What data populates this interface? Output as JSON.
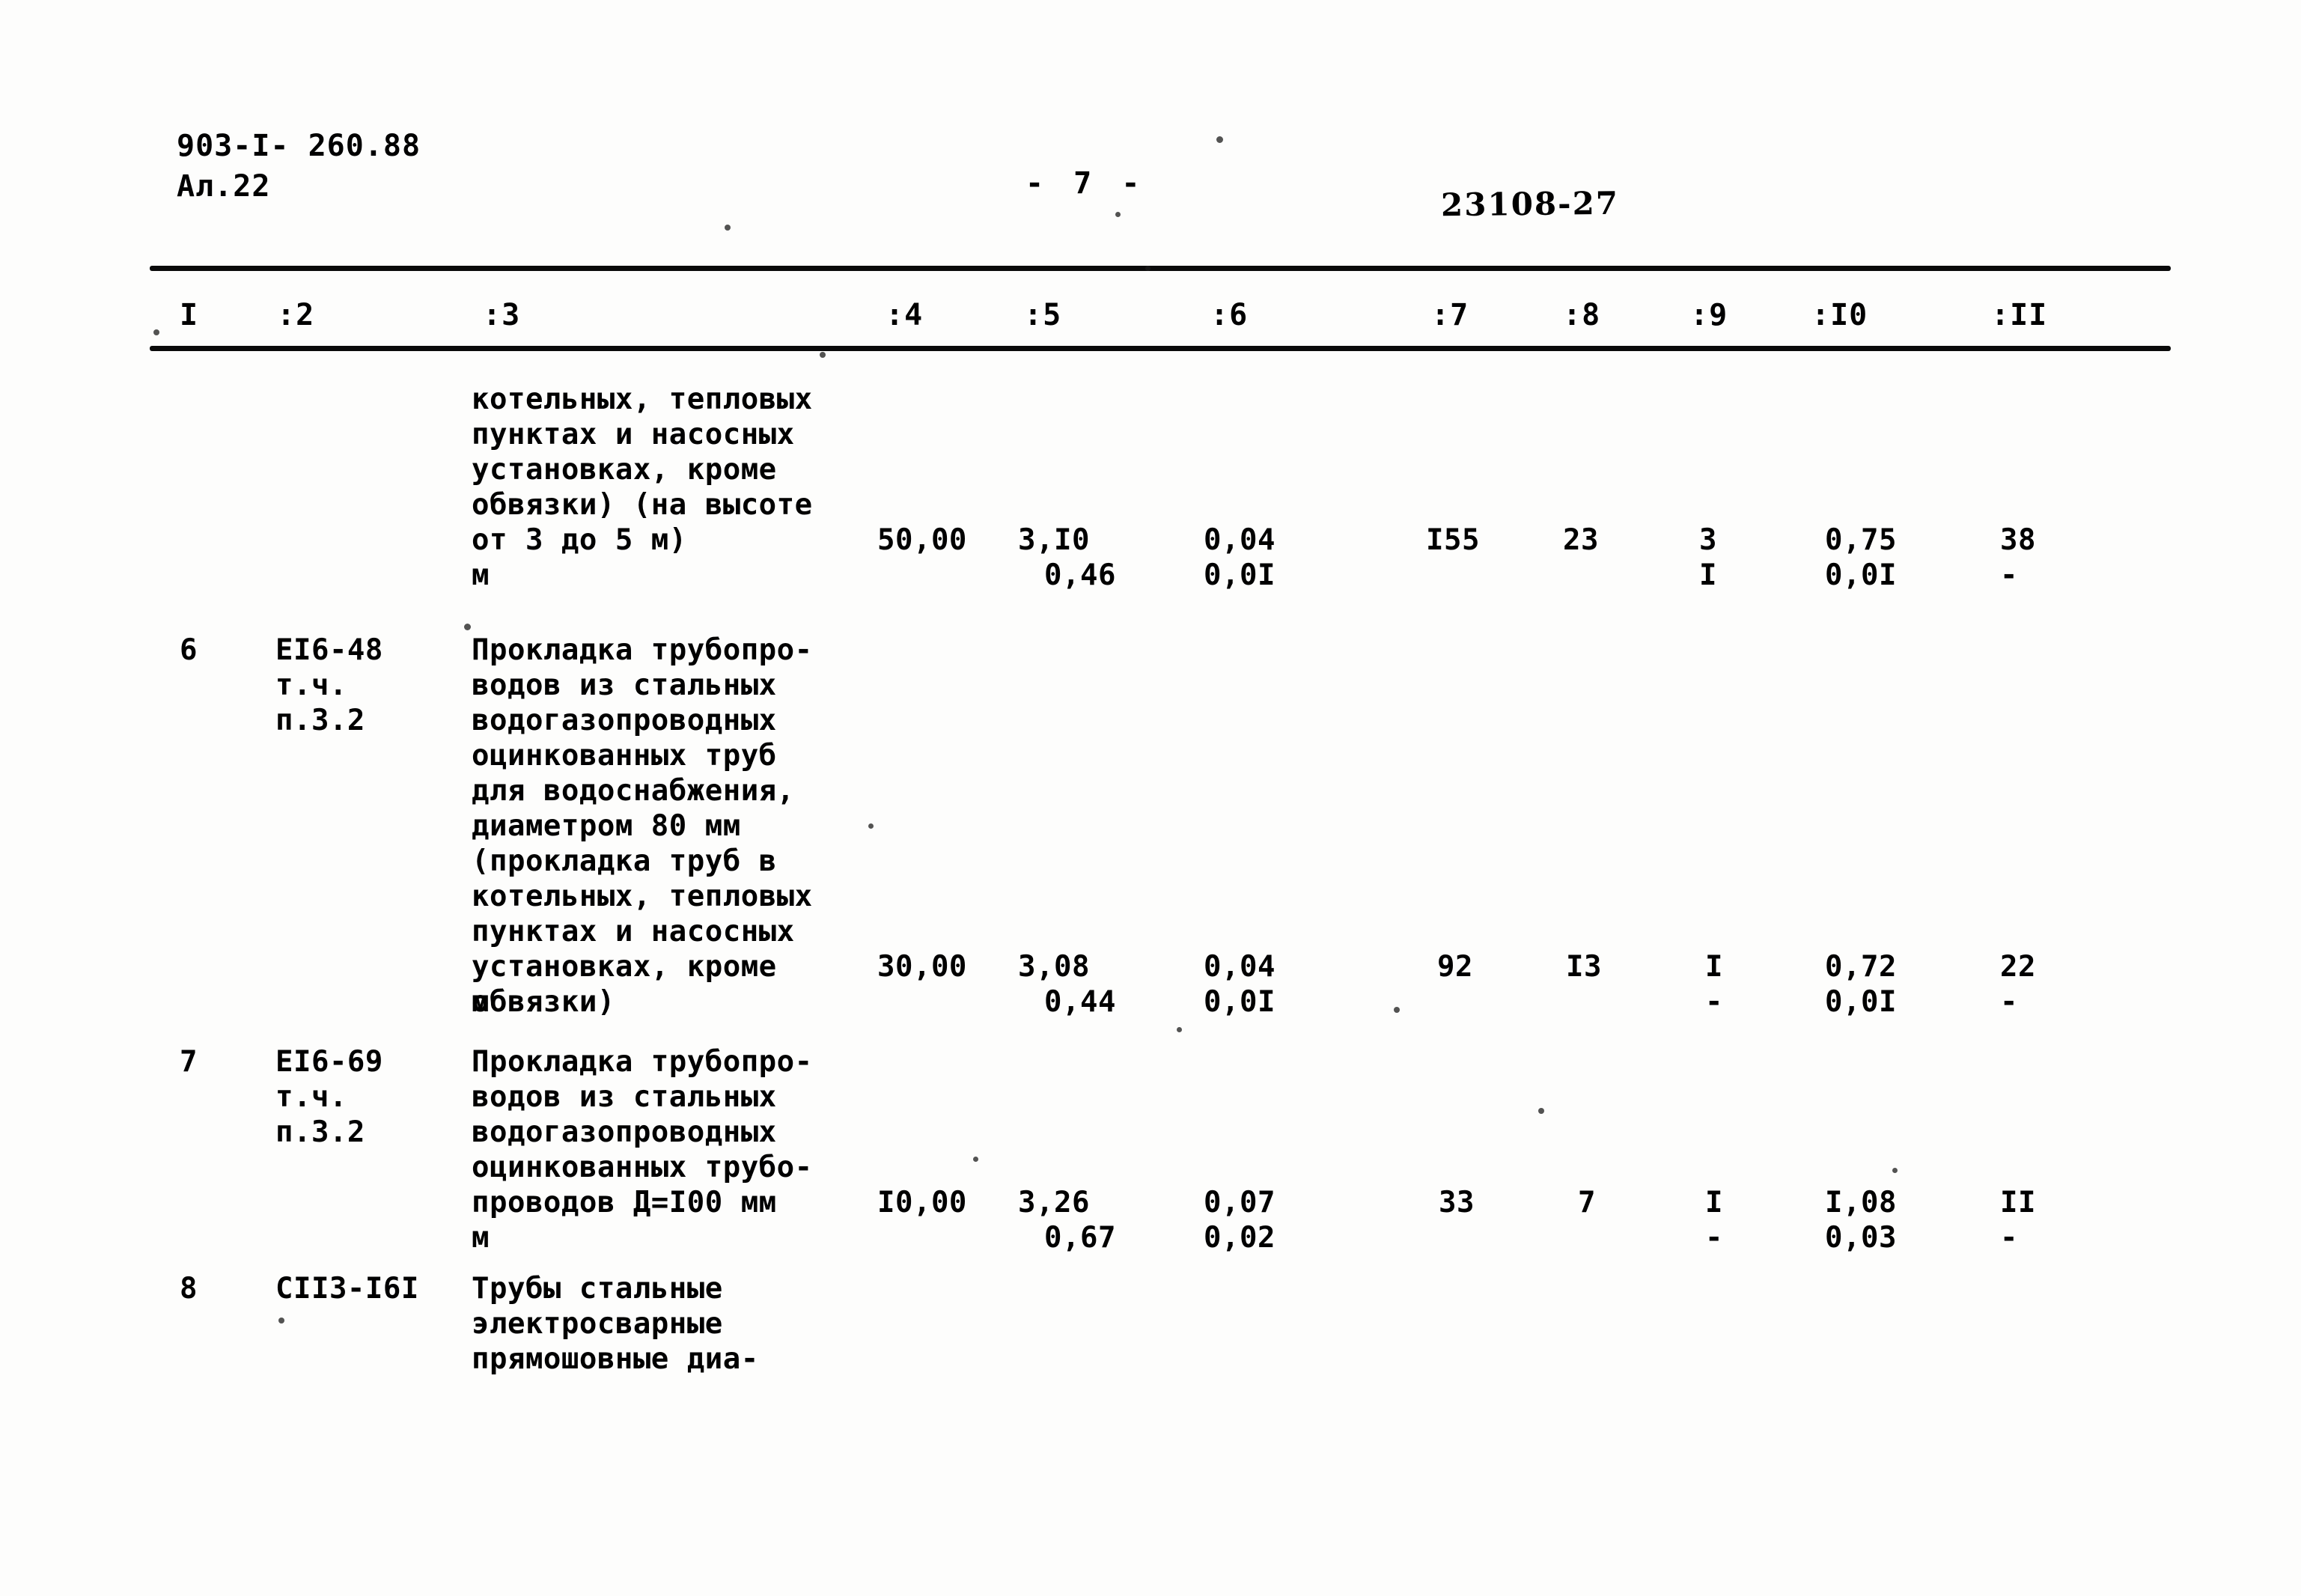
{
  "document": {
    "code": "903-I- 260.88",
    "sheet": "Ал.22",
    "page_marker": "- 7 -",
    "stamp": "23108-27"
  },
  "table": {
    "column_headers": [
      "I",
      ":2",
      ":3",
      ":4",
      ":5",
      ":6",
      ":7",
      ":8",
      ":9",
      ":I0",
      ":II"
    ],
    "rows": [
      {
        "num": "",
        "code": "",
        "description": "котельных, тепловых\nпунктах и насосных\nустановках, кроме\nобвязки) (на высоте\nот 3 до 5 м)",
        "unit": "м",
        "c4": "50,00",
        "c5_top": "3,I0",
        "c5_bot": "0,46",
        "c6_top": "0,04",
        "c6_bot": "0,0I",
        "c7": "I55",
        "c8": "23",
        "c9_top": "3",
        "c9_bot": "I",
        "c10_top": "0,75",
        "c10_bot": "0,0I",
        "c11_top": "38",
        "c11_bot": "-"
      },
      {
        "num": "6",
        "code": "ЕI6-48\nт.ч.\nп.3.2",
        "description": "Прокладка трубопро-\nводов из стальных\nводогазопроводных\nоцинкованных труб\nдля водоснабжения,\nдиаметром 80 мм\n(прокладка труб в\nкотельных, тепловых\nпунктах и насосных\nустановках, кроме\nобвязки)",
        "unit": "м",
        "c4": "30,00",
        "c5_top": "3,08",
        "c5_bot": "0,44",
        "c6_top": "0,04",
        "c6_bot": "0,0I",
        "c7": "92",
        "c8": "I3",
        "c9_top": "I",
        "c9_bot": "-",
        "c10_top": "0,72",
        "c10_bot": "0,0I",
        "c11_top": "22",
        "c11_bot": "-"
      },
      {
        "num": "7",
        "code": "ЕI6-69\nт.ч.\nп.3.2",
        "description": "Прокладка трубопро-\nводов из стальных\nводогазопроводных\nоцинкованных трубо-\nпроводов Д=I00 мм",
        "unit": "м",
        "c4": "I0,00",
        "c5_top": "3,26",
        "c5_bot": "0,67",
        "c6_top": "0,07",
        "c6_bot": "0,02",
        "c7": "33",
        "c8": "7",
        "c9_top": "I",
        "c9_bot": "-",
        "c10_top": "I,08",
        "c10_bot": "0,03",
        "c11_top": "II",
        "c11_bot": "-"
      },
      {
        "num": "8",
        "code": "СII3-I6I",
        "description": "Трубы стальные\nэлектросварные\nпрямошовные диа-",
        "unit": "",
        "c4": "",
        "c5_top": "",
        "c5_bot": "",
        "c6_top": "",
        "c6_bot": "",
        "c7": "",
        "c8": "",
        "c9_top": "",
        "c9_bot": "",
        "c10_top": "",
        "c10_bot": "",
        "c11_top": "",
        "c11_bot": ""
      }
    ]
  }
}
